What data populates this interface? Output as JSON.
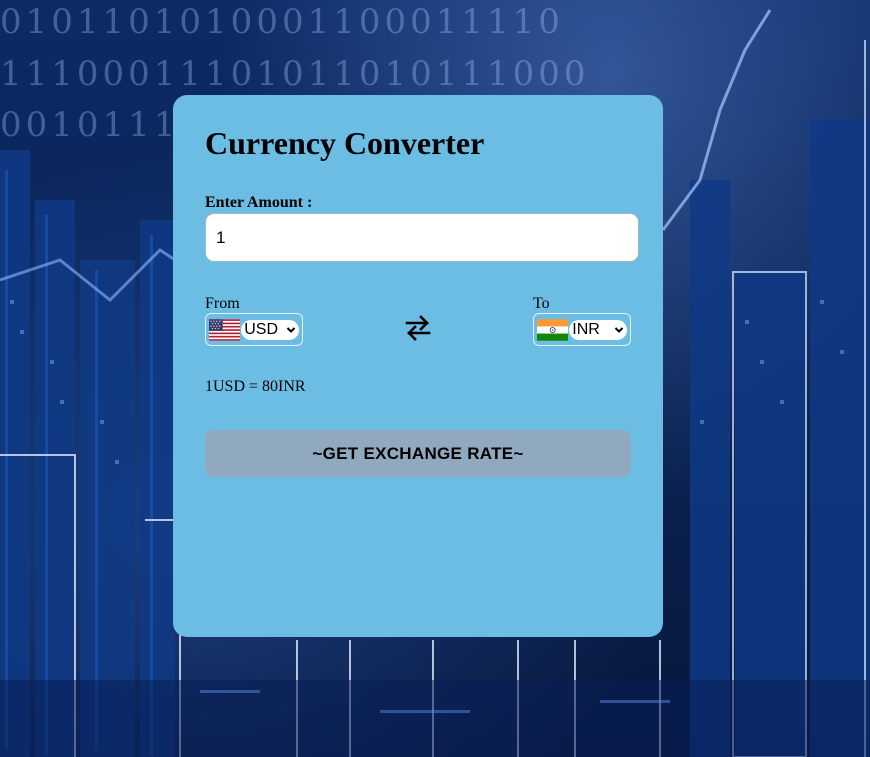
{
  "page": {
    "title": "Currency Converter"
  },
  "background": {
    "binary_rows": [
      "0101101010001100011110",
      "11100011101011010111000",
      "0010111"
    ]
  },
  "converter": {
    "amount_label": "Enter Amount :",
    "amount_value": "1",
    "from_label": "From",
    "to_label": "To",
    "from_currency": "USD",
    "to_currency": "INR",
    "from_flag_icon": "us-flag-icon",
    "to_flag_icon": "india-flag-icon",
    "swap_icon": "swap-arrows-icon",
    "rate_message": "1USD = 80INR",
    "button_label": "~GET EXCHANGE RATE~"
  },
  "colors": {
    "card": "#6bbde4",
    "button": "#90a9bf"
  }
}
